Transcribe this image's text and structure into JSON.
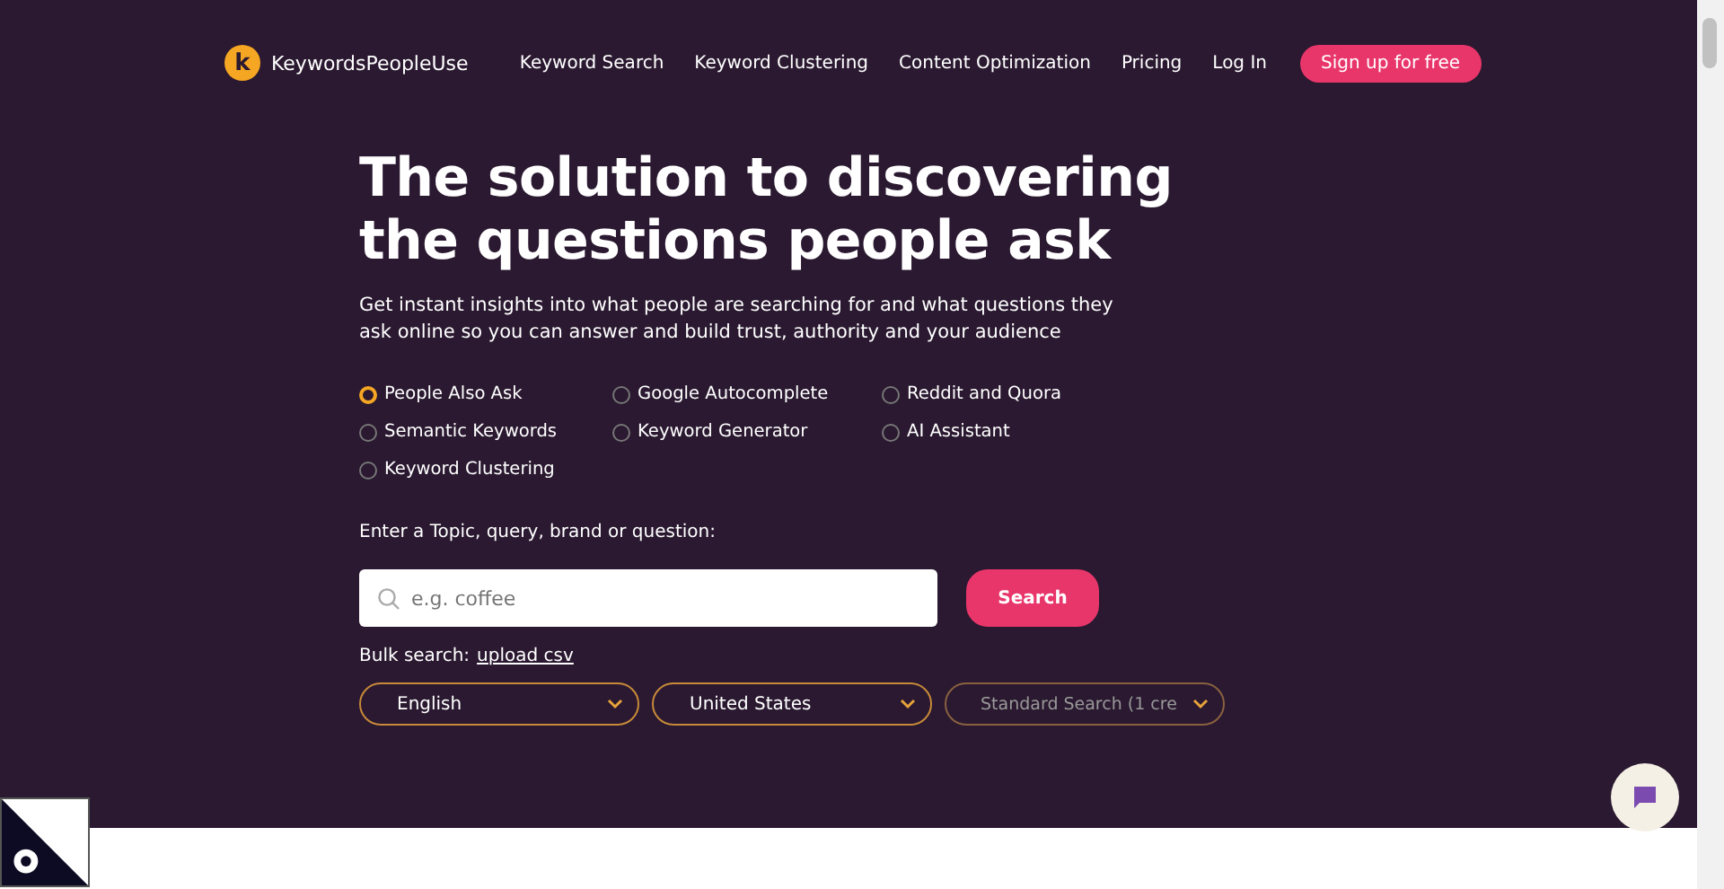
{
  "nav": {
    "brand": "KeywordsPeopleUse",
    "logo_letter": "k",
    "links": [
      "Keyword Search",
      "Keyword Clustering",
      "Content Optimization",
      "Pricing",
      "Log In"
    ],
    "cta": "Sign up for free"
  },
  "hero": {
    "title": "The solution to discovering the questions people ask",
    "subtitle": "Get instant insights into what people are searching for and what questions they ask online so you can answer and build trust, authority and your audience"
  },
  "modes": [
    {
      "label": "People Also Ask",
      "selected": true
    },
    {
      "label": "Google Autocomplete",
      "selected": false
    },
    {
      "label": "Reddit and Quora",
      "selected": false
    },
    {
      "label": "Semantic Keywords",
      "selected": false
    },
    {
      "label": "Keyword Generator",
      "selected": false
    },
    {
      "label": "AI Assistant",
      "selected": false
    },
    {
      "label": "Keyword Clustering",
      "selected": false
    }
  ],
  "search": {
    "label": "Enter a Topic, query, brand or question:",
    "placeholder": "e.g. coffee",
    "button": "Search",
    "bulk_label": "Bulk search:",
    "bulk_link": "upload csv"
  },
  "selects": [
    {
      "value": "English",
      "disabled": false
    },
    {
      "value": "United States",
      "disabled": false
    },
    {
      "value": "Standard Search (1 cre",
      "disabled": true
    }
  ]
}
